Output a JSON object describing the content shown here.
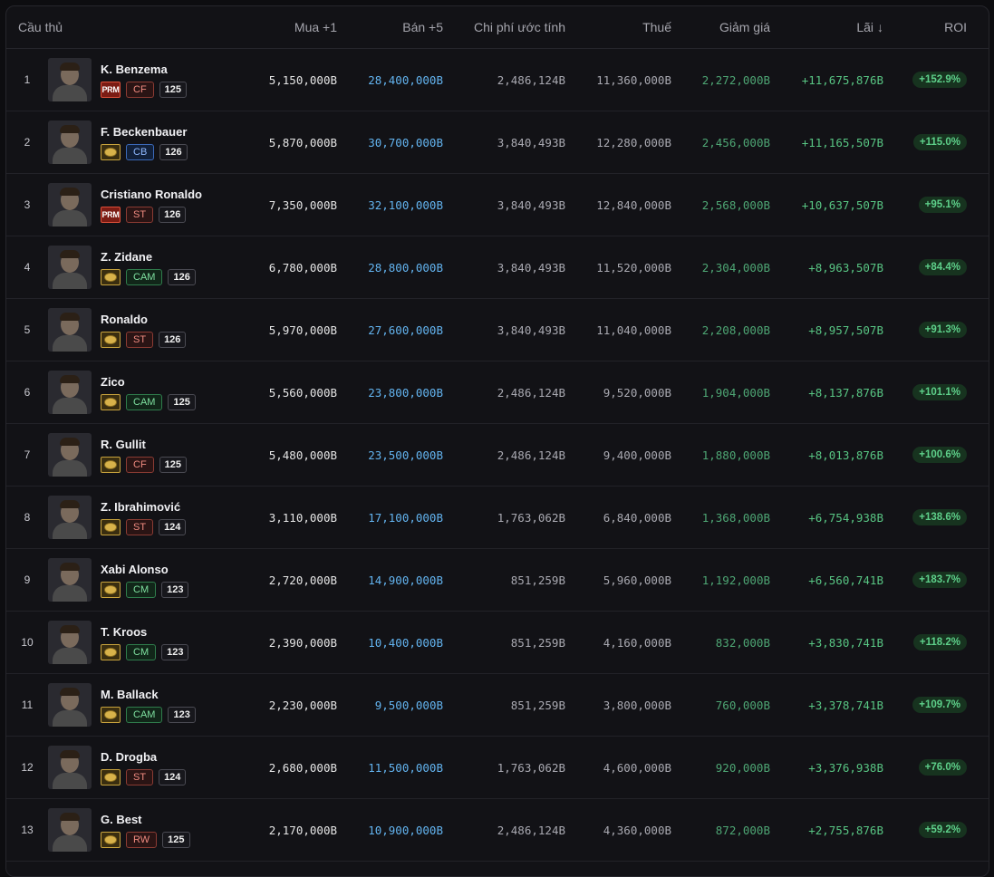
{
  "columns": {
    "player": "Cầu thủ",
    "buy": "Mua +1",
    "sell": "Bán +5",
    "cost": "Chi phí ước tính",
    "tax": "Thuế",
    "discount": "Giảm giá",
    "profit": "Lãi",
    "profit_sort_arrow": "↓",
    "roi": "ROI"
  },
  "rows": [
    {
      "rank": "1",
      "name": "K. Benzema",
      "season": "PRM",
      "pos": "CF",
      "ovr": "125",
      "buy": "5,150,000B",
      "sell": "28,400,000B",
      "cost": "2,486,124B",
      "tax": "11,360,000B",
      "discount": "2,272,000B",
      "profit": "+11,675,876B",
      "roi": "+152.9%"
    },
    {
      "rank": "2",
      "name": "F. Beckenbauer",
      "season": "ICON",
      "pos": "CB",
      "ovr": "126",
      "buy": "5,870,000B",
      "sell": "30,700,000B",
      "cost": "3,840,493B",
      "tax": "12,280,000B",
      "discount": "2,456,000B",
      "profit": "+11,165,507B",
      "roi": "+115.0%"
    },
    {
      "rank": "3",
      "name": "Cristiano Ronaldo",
      "season": "PRM",
      "pos": "ST",
      "ovr": "126",
      "buy": "7,350,000B",
      "sell": "32,100,000B",
      "cost": "3,840,493B",
      "tax": "12,840,000B",
      "discount": "2,568,000B",
      "profit": "+10,637,507B",
      "roi": "+95.1%"
    },
    {
      "rank": "4",
      "name": "Z. Zidane",
      "season": "ICON",
      "pos": "CAM",
      "ovr": "126",
      "buy": "6,780,000B",
      "sell": "28,800,000B",
      "cost": "3,840,493B",
      "tax": "11,520,000B",
      "discount": "2,304,000B",
      "profit": "+8,963,507B",
      "roi": "+84.4%"
    },
    {
      "rank": "5",
      "name": "Ronaldo",
      "season": "ICON",
      "pos": "ST",
      "ovr": "126",
      "buy": "5,970,000B",
      "sell": "27,600,000B",
      "cost": "3,840,493B",
      "tax": "11,040,000B",
      "discount": "2,208,000B",
      "profit": "+8,957,507B",
      "roi": "+91.3%"
    },
    {
      "rank": "6",
      "name": "Zico",
      "season": "ICON",
      "pos": "CAM",
      "ovr": "125",
      "buy": "5,560,000B",
      "sell": "23,800,000B",
      "cost": "2,486,124B",
      "tax": "9,520,000B",
      "discount": "1,904,000B",
      "profit": "+8,137,876B",
      "roi": "+101.1%"
    },
    {
      "rank": "7",
      "name": "R. Gullit",
      "season": "ICON",
      "pos": "CF",
      "ovr": "125",
      "buy": "5,480,000B",
      "sell": "23,500,000B",
      "cost": "2,486,124B",
      "tax": "9,400,000B",
      "discount": "1,880,000B",
      "profit": "+8,013,876B",
      "roi": "+100.6%"
    },
    {
      "rank": "8",
      "name": "Z. Ibrahimović",
      "season": "ICON",
      "pos": "ST",
      "ovr": "124",
      "buy": "3,110,000B",
      "sell": "17,100,000B",
      "cost": "1,763,062B",
      "tax": "6,840,000B",
      "discount": "1,368,000B",
      "profit": "+6,754,938B",
      "roi": "+138.6%"
    },
    {
      "rank": "9",
      "name": "Xabi Alonso",
      "season": "ICON",
      "pos": "CM",
      "ovr": "123",
      "buy": "2,720,000B",
      "sell": "14,900,000B",
      "cost": "851,259B",
      "tax": "5,960,000B",
      "discount": "1,192,000B",
      "profit": "+6,560,741B",
      "roi": "+183.7%"
    },
    {
      "rank": "10",
      "name": "T. Kroos",
      "season": "ICON",
      "pos": "CM",
      "ovr": "123",
      "buy": "2,390,000B",
      "sell": "10,400,000B",
      "cost": "851,259B",
      "tax": "4,160,000B",
      "discount": "832,000B",
      "profit": "+3,830,741B",
      "roi": "+118.2%"
    },
    {
      "rank": "11",
      "name": "M. Ballack",
      "season": "ICON",
      "pos": "CAM",
      "ovr": "123",
      "buy": "2,230,000B",
      "sell": "9,500,000B",
      "cost": "851,259B",
      "tax": "3,800,000B",
      "discount": "760,000B",
      "profit": "+3,378,741B",
      "roi": "+109.7%"
    },
    {
      "rank": "12",
      "name": "D. Drogba",
      "season": "ICON",
      "pos": "ST",
      "ovr": "124",
      "buy": "2,680,000B",
      "sell": "11,500,000B",
      "cost": "1,763,062B",
      "tax": "4,600,000B",
      "discount": "920,000B",
      "profit": "+3,376,938B",
      "roi": "+76.0%"
    },
    {
      "rank": "13",
      "name": "G. Best",
      "season": "ICON",
      "pos": "RW",
      "ovr": "125",
      "buy": "2,170,000B",
      "sell": "10,900,000B",
      "cost": "2,486,124B",
      "tax": "4,360,000B",
      "discount": "872,000B",
      "profit": "+2,755,876B",
      "roi": "+59.2%"
    }
  ],
  "colors": {
    "sell": "#63b4f0",
    "discount": "#4ea674",
    "profit": "#58c583",
    "roi_badge": "#17331f"
  }
}
